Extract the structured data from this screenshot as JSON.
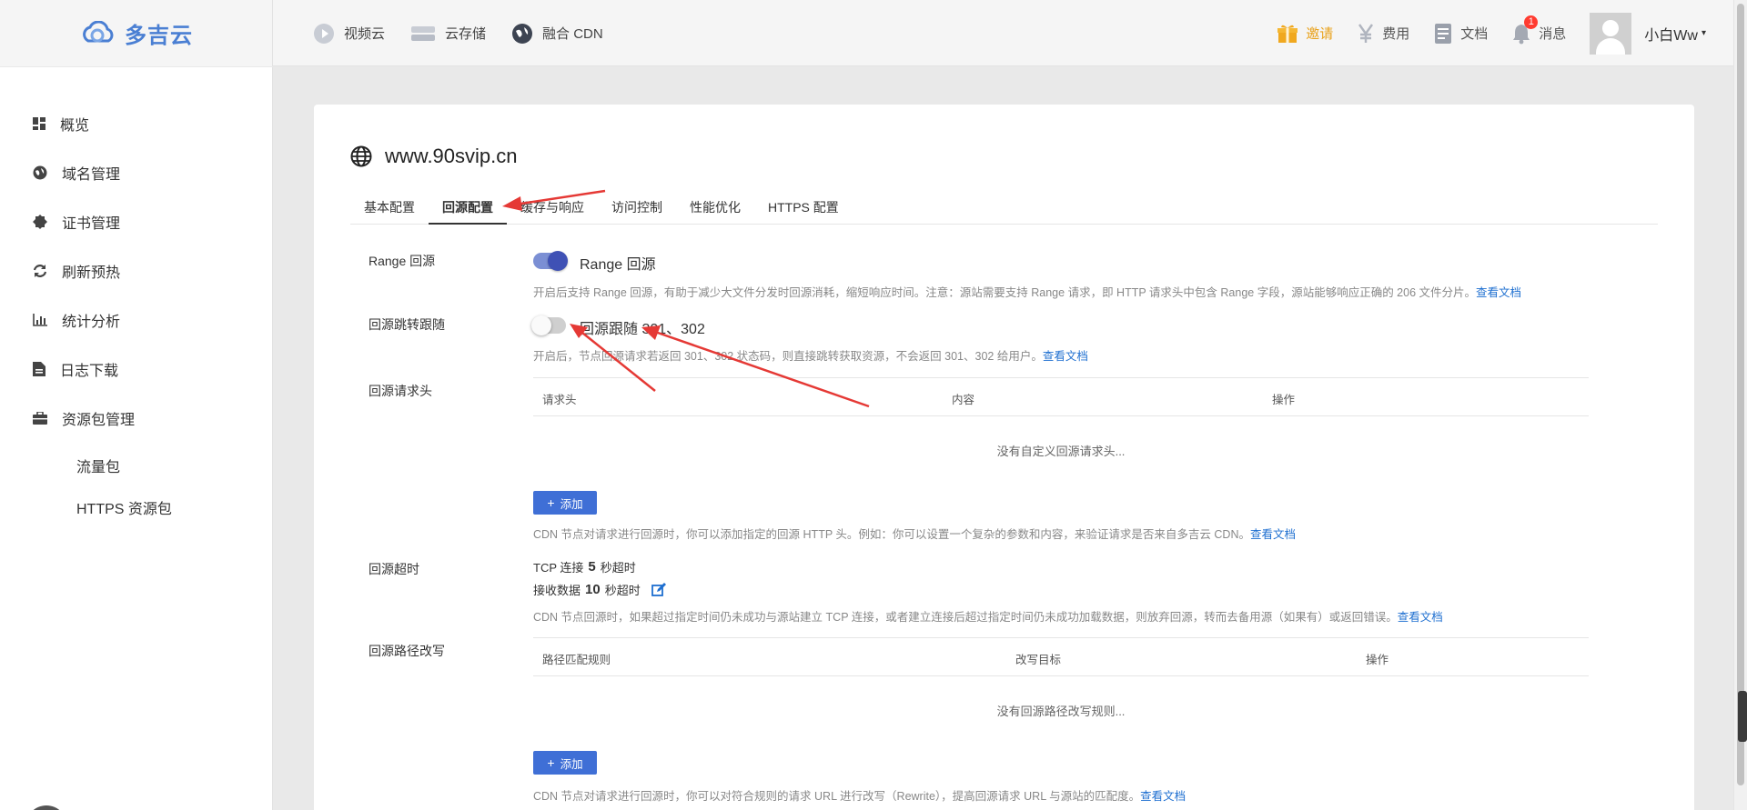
{
  "brand": {
    "name": "多吉云"
  },
  "top_nav": [
    {
      "label": "视频云",
      "icon": "play-icon"
    },
    {
      "label": "云存储",
      "icon": "storage-icon"
    },
    {
      "label": "融合 CDN",
      "icon": "globe-icon"
    }
  ],
  "top_right": {
    "invite": "邀请",
    "fee": "费用",
    "docs": "文档",
    "messages": "消息",
    "message_count": "1",
    "username": "小白Ww"
  },
  "sidebar": {
    "items": [
      {
        "label": "概览",
        "icon": "dashboard-icon"
      },
      {
        "label": "域名管理",
        "icon": "globe-icon"
      },
      {
        "label": "证书管理",
        "icon": "certificate-icon"
      },
      {
        "label": "刷新预热",
        "icon": "refresh-icon"
      },
      {
        "label": "统计分析",
        "icon": "chart-icon"
      },
      {
        "label": "日志下载",
        "icon": "file-icon"
      },
      {
        "label": "资源包管理",
        "icon": "briefcase-icon"
      }
    ],
    "sub_items": [
      {
        "label": "流量包"
      },
      {
        "label": "HTTPS 资源包"
      }
    ]
  },
  "main": {
    "domain": "www.90svip.cn",
    "tabs": [
      {
        "label": "基本配置",
        "active": false
      },
      {
        "label": "回源配置",
        "active": true
      },
      {
        "label": "缓存与响应",
        "active": false
      },
      {
        "label": "访问控制",
        "active": false
      },
      {
        "label": "性能优化",
        "active": false
      },
      {
        "label": "HTTPS 配置",
        "active": false
      }
    ],
    "range": {
      "label": "Range 回源",
      "switch_label": "Range 回源",
      "enabled": true,
      "desc": "开启后支持 Range 回源，有助于减少大文件分发时回源消耗，缩短响应时间。注意：源站需要支持 Range 请求，即 HTTP 请求头中包含 Range 字段，源站能够响应正确的 206 文件分片。",
      "link": "查看文档"
    },
    "redirect": {
      "label": "回源跳转跟随",
      "switch_label": "回源跟随 301、302",
      "enabled": false,
      "desc": "开启后，节点回源请求若返回 301、302 状态码，则直接跳转获取资源，不会返回 301、302 给用户。",
      "link": "查看文档"
    },
    "headers": {
      "label": "回源请求头",
      "columns": [
        "请求头",
        "内容",
        "操作"
      ],
      "empty": "没有自定义回源请求头...",
      "add_button": "添加",
      "desc": "CDN 节点对请求进行回源时，你可以添加指定的回源 HTTP 头。例如：你可以设置一个复杂的参数和内容，来验证请求是否来自多吉云 CDN。",
      "link": "查看文档"
    },
    "timeout": {
      "label": "回源超时",
      "tcp_prefix": "TCP 连接",
      "tcp_value": "5",
      "tcp_suffix": "秒超时",
      "recv_prefix": "接收数据",
      "recv_value": "10",
      "recv_suffix": "秒超时",
      "desc": "CDN 节点回源时，如果超过指定时间仍未成功与源站建立 TCP 连接，或者建立连接后超过指定时间仍未成功加载数据，则放弃回源，转而去备用源（如果有）或返回错误。",
      "link": "查看文档"
    },
    "rewrite": {
      "label": "回源路径改写",
      "columns": [
        "路径匹配规则",
        "改写目标",
        "操作"
      ],
      "empty": "没有回源路径改写规则...",
      "add_button": "添加",
      "desc": "CDN 节点对请求进行回源时，你可以对符合规则的请求 URL 进行改写（Rewrite），提高回源请求 URL 与源站的匹配度。",
      "link": "查看文档"
    }
  },
  "colors": {
    "brand": "#4a7fd3",
    "accent": "#3f51b5",
    "button": "#3f6fd6",
    "link": "#1e6fd0",
    "invite": "#e9a21c",
    "annotation_arrow": "#e53935"
  }
}
